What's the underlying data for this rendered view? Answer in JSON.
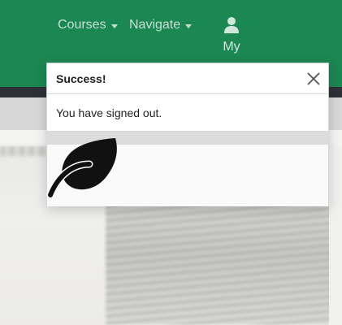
{
  "navbar": {
    "items": [
      {
        "label": "Courses"
      },
      {
        "label": "Navigate"
      }
    ],
    "user": {
      "label": "My"
    }
  },
  "modal": {
    "title": "Success!",
    "message": "You have signed out."
  },
  "icons": {
    "close": "close-icon",
    "user": "user-icon",
    "logo": "leaf-icon"
  },
  "colors": {
    "navbar": "#1b8753",
    "darkbar": "#2d3136",
    "logo": "#111111"
  }
}
